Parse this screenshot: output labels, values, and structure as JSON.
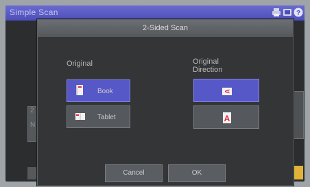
{
  "app": {
    "title": "Simple Scan"
  },
  "dialog": {
    "title": "2-Sided Scan",
    "original_label": "Original",
    "direction_label": "Original Direction",
    "options": [
      {
        "label": "Book",
        "selected": true,
        "icon": "book-icon"
      },
      {
        "label": "Tablet",
        "selected": false,
        "icon": "tablet-icon"
      }
    ],
    "directions": [
      {
        "selected": true,
        "icon": "rotated-a-icon"
      },
      {
        "selected": false,
        "icon": "upright-a-icon"
      }
    ],
    "cancel_label": "Cancel",
    "ok_label": "OK"
  },
  "background": {
    "left_letters": [
      "2",
      "N"
    ]
  },
  "colors": {
    "accent": "#5758c8",
    "highlight": "#e0b43a",
    "icon_red": "#e8243a"
  }
}
